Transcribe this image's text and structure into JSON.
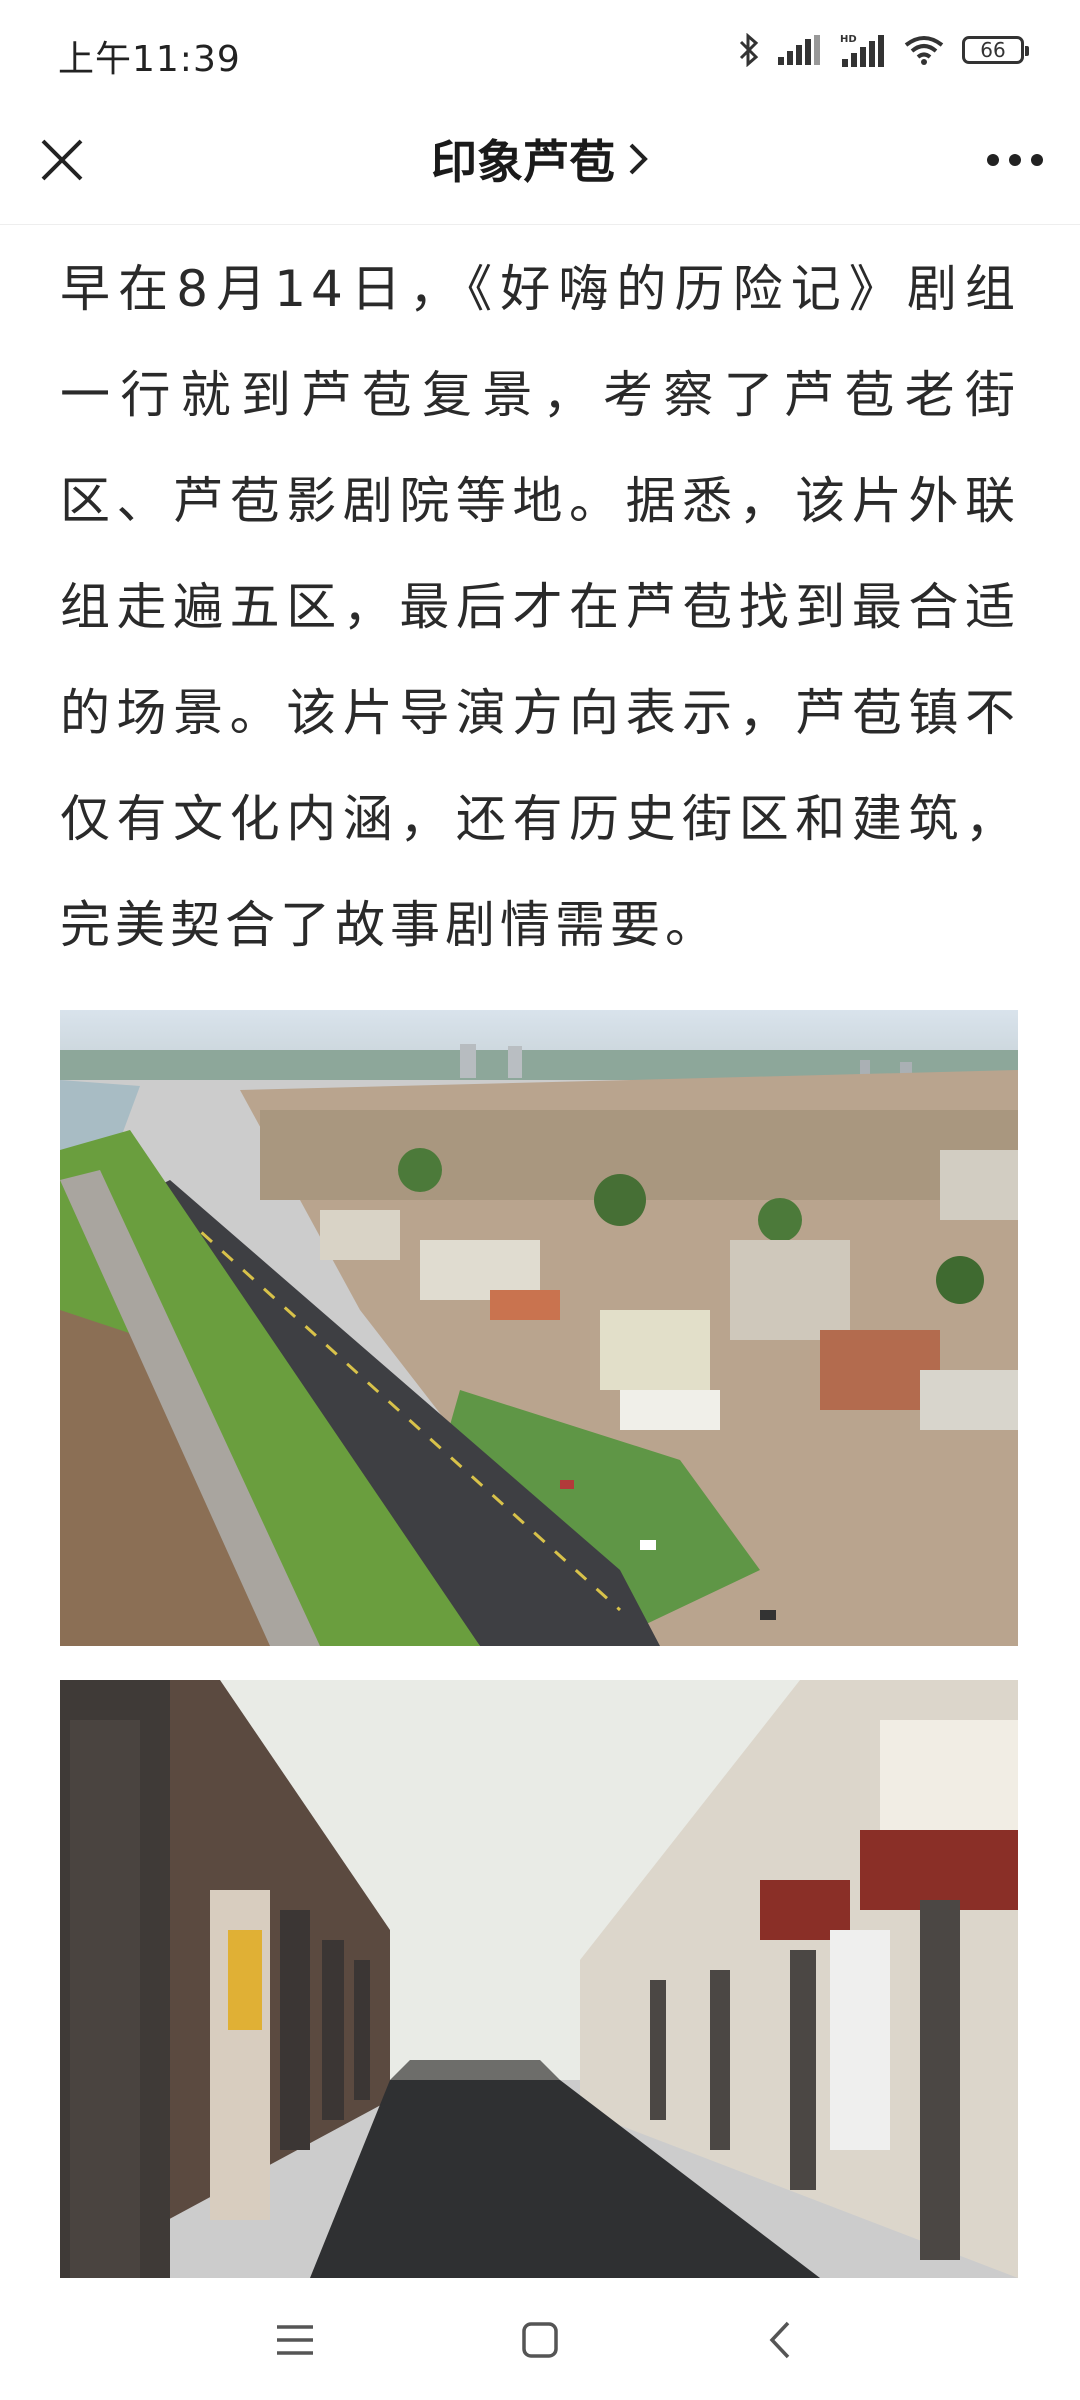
{
  "status_bar": {
    "time": "上午11:39",
    "battery": "66",
    "icons": [
      "bluetooth-icon",
      "signal-icon",
      "hd-signal-icon",
      "wifi-icon",
      "battery-icon"
    ]
  },
  "nav": {
    "title": "印象芦苞",
    "title_chevron": "›",
    "close_icon": "close-icon",
    "more_icon": "more-icon"
  },
  "article": {
    "paragraph": "早在8月14日，《好嗨的历险记》剧组一行就到芦苞复景，考察了芦苞老街区、芦苞影剧院等地。据悉，该片外联组走遍五区，最后才在芦苞找到最合适的场景。该片导演方向表示，芦苞镇不仅有文化内涵，还有历史街区和建筑，完美契合了故事剧情需要。"
  },
  "bottom_nav": {
    "icons": [
      "menu-icon",
      "home-icon",
      "back-icon"
    ]
  },
  "colors": {
    "text": "#2a2a2a",
    "background": "#ffffff"
  }
}
